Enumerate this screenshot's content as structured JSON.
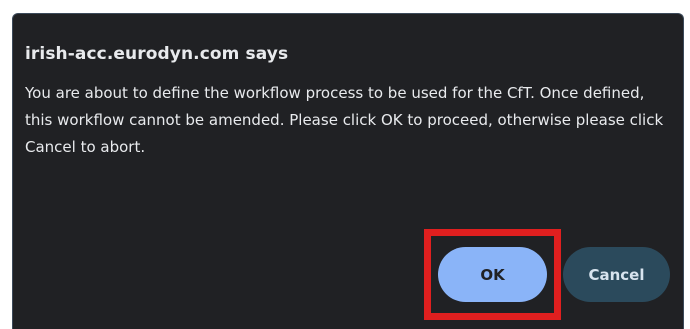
{
  "dialog": {
    "title": "irish-acc.eurodyn.com says",
    "message": "You are about to define the workflow process to be used for the CfT. Once defined, this workflow cannot be amended. Please click OK to proceed, otherwise please click Cancel to abort.",
    "buttons": {
      "ok_label": "OK",
      "cancel_label": "Cancel"
    }
  },
  "colors": {
    "dialog_background": "#202124",
    "text": "#e8eaed",
    "ok_button": "#8ab4f8",
    "cancel_button": "#2b4a5c",
    "highlight": "#e01f1f"
  }
}
